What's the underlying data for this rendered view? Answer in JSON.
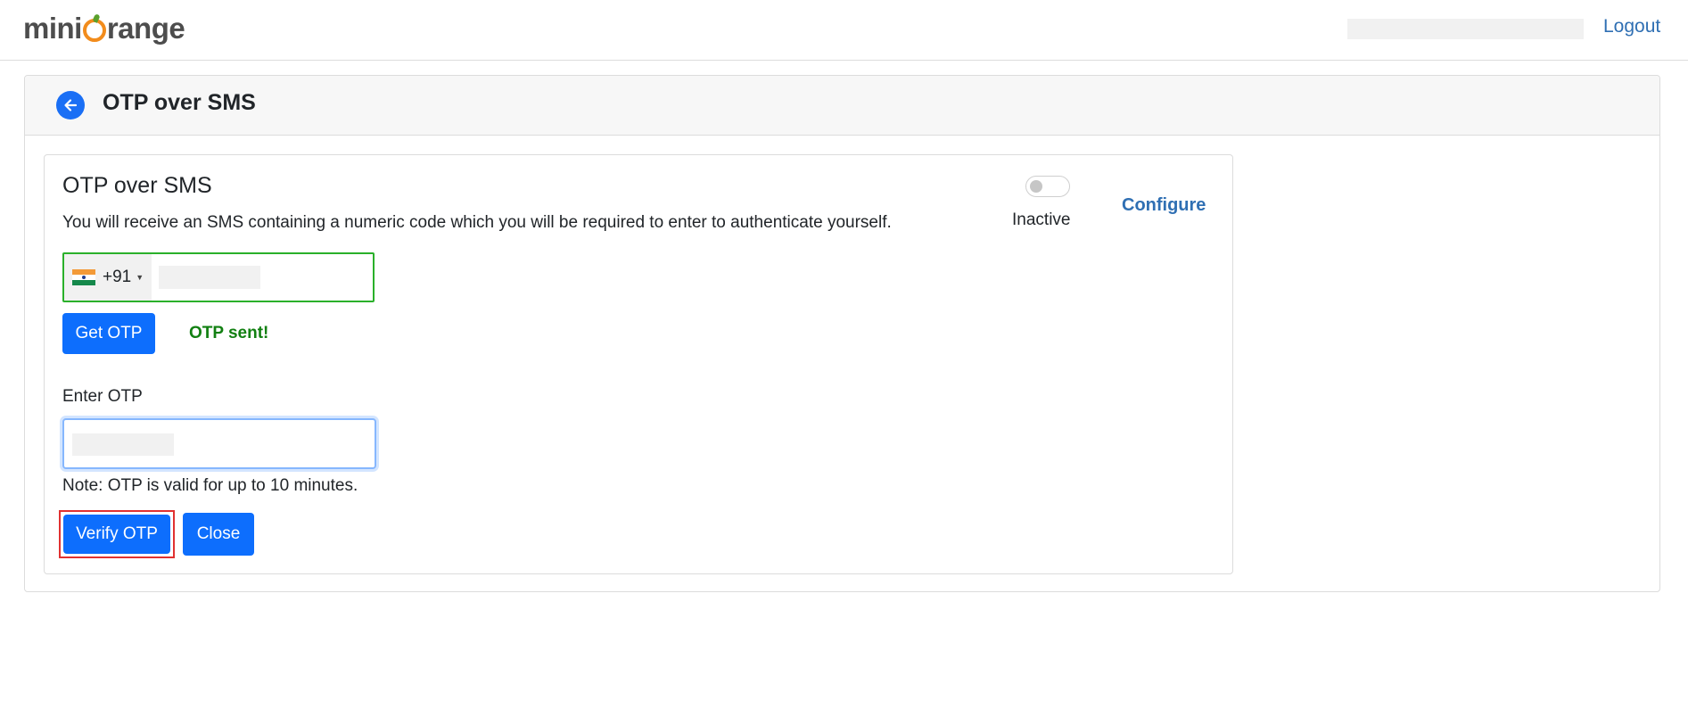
{
  "header": {
    "logo_prefix": "mini",
    "logo_suffix": "range",
    "logout_label": "Logout"
  },
  "page": {
    "title": "OTP over SMS"
  },
  "method_card": {
    "title": "OTP over SMS",
    "description": "You will receive an SMS containing a numeric code which you will be required to enter to authenticate yourself.",
    "toggle_state": "off",
    "status_label": "Inactive",
    "configure_label": "Configure"
  },
  "phone": {
    "dial_code": "+91",
    "country_flag": "india-flag-icon"
  },
  "actions": {
    "get_otp_label": "Get OTP",
    "otp_sent_message": "OTP sent!",
    "verify_label": "Verify OTP",
    "close_label": "Close"
  },
  "otp": {
    "label": "Enter OTP",
    "note": "Note: OTP is valid for up to 10 minutes."
  },
  "colors": {
    "primary": "#0d6efd",
    "link": "#2f6fb3",
    "success": "#128012",
    "highlight": "#e03131",
    "brand_orange": "#f28c1c"
  }
}
